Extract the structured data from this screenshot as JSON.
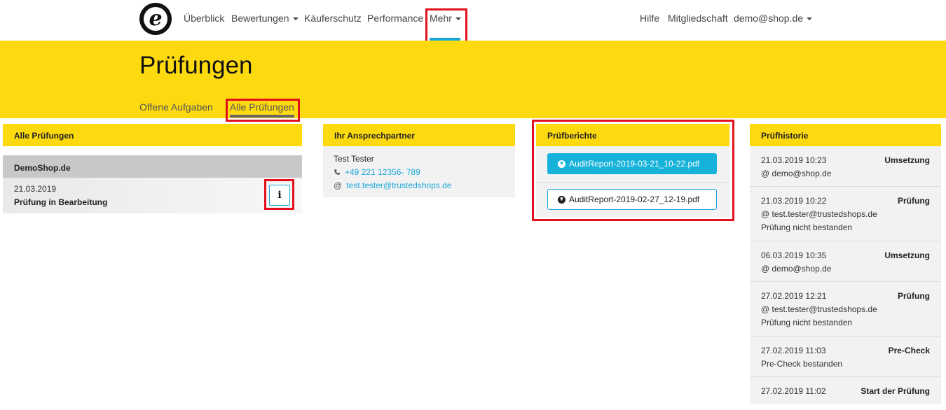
{
  "nav": {
    "logo_letter": "e",
    "links": [
      "Überblick",
      "Bewertungen",
      "Käuferschutz",
      "Performance",
      "Mehr"
    ],
    "right_links": [
      "Hilfe",
      "Mitgliedschaft",
      "demo@shop.de"
    ]
  },
  "page": {
    "title": "Prüfungen",
    "tabs": [
      "Offene Aufgaben",
      "Alle Prüfungen"
    ],
    "active_tab": "Alle Prüfungen"
  },
  "all_audits": {
    "heading": "Alle Prüfungen",
    "shop_name": "DemoShop.de",
    "date": "21.03.2019",
    "status": "Prüfung in Bearbeitung",
    "info_label": "i"
  },
  "contact": {
    "heading": "Ihr Ansprechpartner",
    "name": "Test Tester",
    "phone": "+49 221 12356- 789",
    "email": "test.tester@trustedshops.de"
  },
  "reports": {
    "heading": "Prüfberichte",
    "files": [
      "AuditReport-2019-03-21_10-22.pdf",
      "AuditReport-2019-02-27_12-19.pdf"
    ]
  },
  "history": {
    "heading": "Prüfhistorie",
    "entries": [
      {
        "datetime": "21.03.2019 10:23",
        "type": "Umsetzung",
        "user": "@ demo@shop.de",
        "note": ""
      },
      {
        "datetime": "21.03.2019 10:22",
        "type": "Prüfung",
        "user": "@ test.tester@trustedshops.de",
        "note": "Prüfung nicht bestanden"
      },
      {
        "datetime": "06.03.2019 10:35",
        "type": "Umsetzung",
        "user": "@ demo@shop.de",
        "note": ""
      },
      {
        "datetime": "27.02.2019 12:21",
        "type": "Prüfung",
        "user": "@ test.tester@trustedshops.de",
        "note": "Prüfung nicht bestanden"
      },
      {
        "datetime": "27.02.2019 11:03",
        "type": "Pre-Check",
        "user": "",
        "note": "Pre-Check bestanden"
      },
      {
        "datetime": "27.02.2019 11:02",
        "type": "Start der Prüfung",
        "user": "",
        "note": ""
      }
    ]
  },
  "colors": {
    "accent_yellow": "#fdda10",
    "link_blue": "#1ba6d8",
    "highlight_red": "#e3101d"
  },
  "icons": [
    "trustedshops-logo-icon",
    "caret-down-icon",
    "phone-icon",
    "at-icon",
    "info-icon",
    "download-circle-icon"
  ]
}
